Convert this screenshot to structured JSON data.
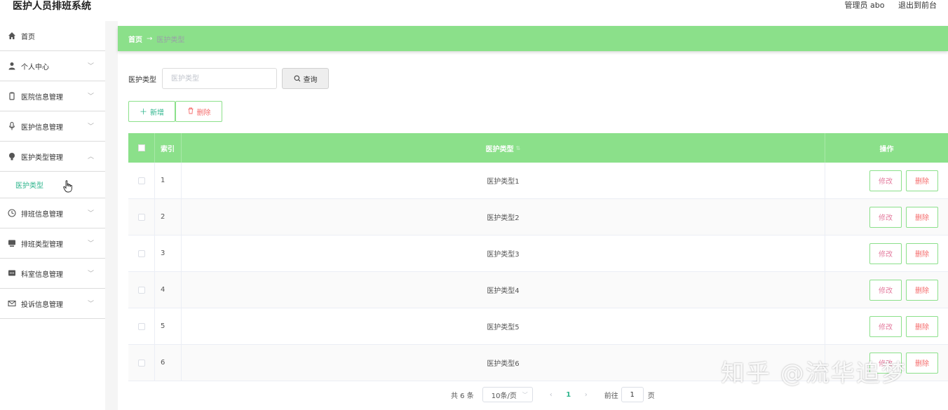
{
  "app": {
    "title": "医护人员排班系统"
  },
  "header": {
    "user_label": "管理员 abo",
    "exit_label": "退出到前台"
  },
  "sidebar": {
    "items": [
      {
        "label": "首页",
        "icon": "home-icon"
      },
      {
        "label": "个人中心",
        "icon": "user-icon"
      },
      {
        "label": "医院信息管理",
        "icon": "clipboard-icon"
      },
      {
        "label": "医护信息管理",
        "icon": "microphone-icon"
      },
      {
        "label": "医护类型管理",
        "icon": "bulb-icon"
      },
      {
        "label": "排班信息管理",
        "icon": "clock-icon"
      },
      {
        "label": "排班类型管理",
        "icon": "monitor-icon"
      },
      {
        "label": "科室信息管理",
        "icon": "chat-icon"
      },
      {
        "label": "投诉信息管理",
        "icon": "mail-icon"
      }
    ],
    "active_sub": "医护类型"
  },
  "breadcrumb": {
    "home": "首页",
    "arrow": "→",
    "current": "医护类型"
  },
  "search": {
    "label": "医护类型",
    "placeholder": "医护类型",
    "value": "",
    "button": "查询"
  },
  "actions": {
    "add": "新增",
    "delete": "删除"
  },
  "table": {
    "columns": {
      "index": "索引",
      "type": "医护类型",
      "ops": "操作"
    },
    "rows": [
      {
        "index": "1",
        "type": "医护类型1"
      },
      {
        "index": "2",
        "type": "医护类型2"
      },
      {
        "index": "3",
        "type": "医护类型3"
      },
      {
        "index": "4",
        "type": "医护类型4"
      },
      {
        "index": "5",
        "type": "医护类型5"
      },
      {
        "index": "6",
        "type": "医护类型6"
      }
    ],
    "edit_label": "修改",
    "delete_label": "删除"
  },
  "pagination": {
    "total": "共 6 条",
    "page_size": "10条/页",
    "current_page": "1",
    "goto_label": "前往",
    "goto_value": "1",
    "page_unit": "页"
  },
  "watermark": "知乎 @流华追梦",
  "colors": {
    "accent": "#8be08a",
    "active_text": "#2fb58d",
    "danger": "#f56c6c"
  }
}
